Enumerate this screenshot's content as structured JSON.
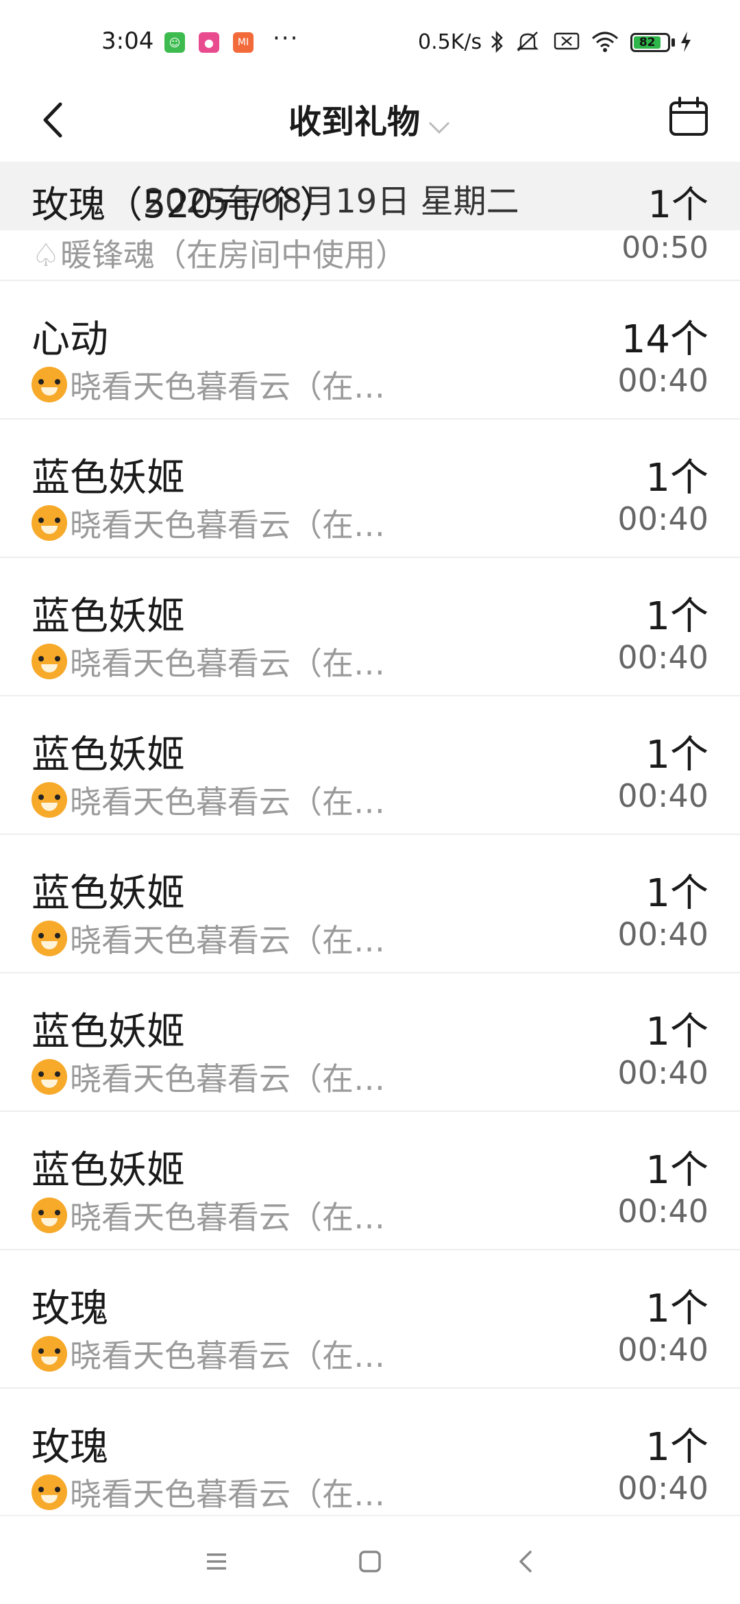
{
  "status_bar": {
    "time": "3:04",
    "more": "···",
    "net_speed": "0.5K/s",
    "battery_level": "82",
    "notif_icons": [
      "app-green-icon",
      "app-pink-icon",
      "mi-icon"
    ],
    "mi_label": "MI",
    "colors": {
      "battery": "#2fb64a"
    }
  },
  "header": {
    "title": "收到礼物"
  },
  "sticky": {
    "name": "玫瑰（520元/个）",
    "date": "2025年08月19日 星期二",
    "count": "1个"
  },
  "partial_row": {
    "sender": "暖锋魂（在房间中使用）",
    "time": "00:50"
  },
  "gifts": [
    {
      "name": "心动",
      "count": "14个",
      "sender": "晓看天色暮看云（在…",
      "time": "00:40"
    },
    {
      "name": "蓝色妖姬",
      "count": "1个",
      "sender": "晓看天色暮看云（在…",
      "time": "00:40"
    },
    {
      "name": "蓝色妖姬",
      "count": "1个",
      "sender": "晓看天色暮看云（在…",
      "time": "00:40"
    },
    {
      "name": "蓝色妖姬",
      "count": "1个",
      "sender": "晓看天色暮看云（在…",
      "time": "00:40"
    },
    {
      "name": "蓝色妖姬",
      "count": "1个",
      "sender": "晓看天色暮看云（在…",
      "time": "00:40"
    },
    {
      "name": "蓝色妖姬",
      "count": "1个",
      "sender": "晓看天色暮看云（在…",
      "time": "00:40"
    },
    {
      "name": "蓝色妖姬",
      "count": "1个",
      "sender": "晓看天色暮看云（在…",
      "time": "00:40"
    },
    {
      "name": "玫瑰",
      "count": "1个",
      "sender": "晓看天色暮看云（在…",
      "time": "00:40"
    },
    {
      "name": "玫瑰",
      "count": "1个",
      "sender": "晓看天色暮看云（在…",
      "time": "00:40"
    }
  ]
}
